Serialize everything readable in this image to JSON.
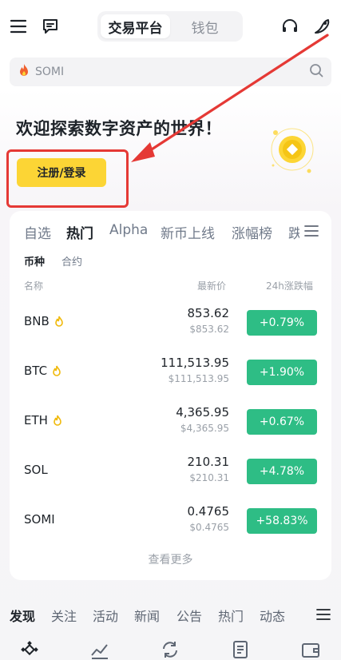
{
  "header": {
    "segments": [
      "交易平台",
      "钱包"
    ]
  },
  "search": {
    "placeholder": "SOMI"
  },
  "hero": {
    "title": "欢迎探索数字资产的世界！",
    "cta_label": "注册/登录"
  },
  "market": {
    "tabs": [
      "自选",
      "热门",
      "Alpha",
      "新币上线",
      "涨幅榜",
      "跌"
    ],
    "active_tab": "热门",
    "subtabs": [
      "币种",
      "合约"
    ],
    "columns": {
      "name": "名称",
      "price": "最新价",
      "change": "24h涨跌幅"
    },
    "rows": [
      {
        "symbol": "BNB",
        "price": "853.62",
        "fiat": "$853.62",
        "change": "+0.79%",
        "flame": true
      },
      {
        "symbol": "BTC",
        "price": "111,513.95",
        "fiat": "$111,513.95",
        "change": "+1.90%",
        "flame": true
      },
      {
        "symbol": "ETH",
        "price": "4,365.95",
        "fiat": "$4,365.95",
        "change": "+0.67%",
        "flame": true
      },
      {
        "symbol": "SOL",
        "price": "210.31",
        "fiat": "$210.31",
        "change": "+4.78%",
        "flame": false
      },
      {
        "symbol": "SOMI",
        "price": "0.4765",
        "fiat": "$0.4765",
        "change": "+58.83%",
        "flame": false
      }
    ],
    "view_more": "查看更多"
  },
  "feed_tabs": [
    "发现",
    "关注",
    "活动",
    "新闻",
    "公告",
    "热门",
    "动态"
  ],
  "bottom_nav": [
    "home-icon",
    "markets-icon",
    "trade-icon",
    "futures-icon",
    "wallet-icon"
  ],
  "colors": {
    "accent": "#fcd535",
    "up": "#2ebd85",
    "highlight": "#e53935"
  }
}
